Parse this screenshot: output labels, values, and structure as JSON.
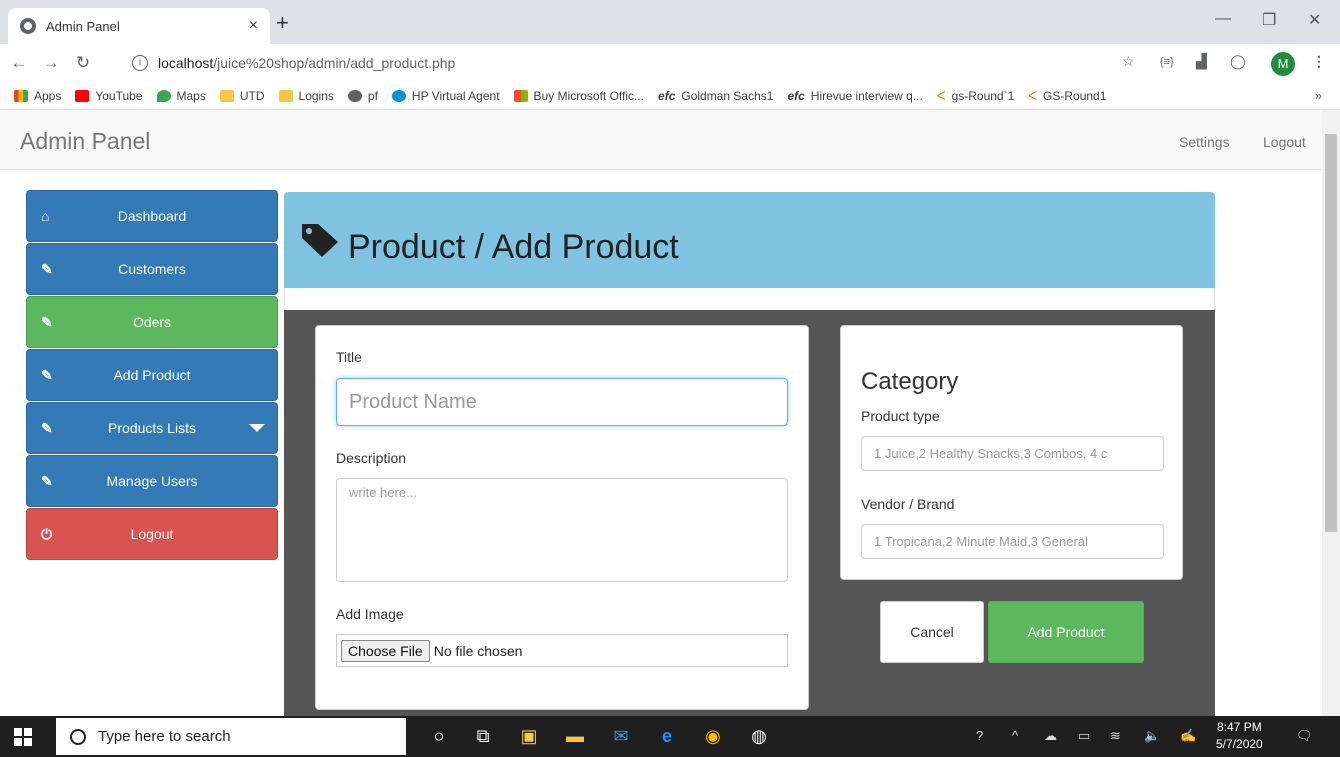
{
  "browser": {
    "tab_title": "Admin Panel",
    "tab_close": "×",
    "new_tab": "+",
    "url_host": "localhost",
    "url_path": "/juice%20shop/admin/add_product.php",
    "profile_initial": "M",
    "bookmarks": [
      "Apps",
      "YouTube",
      "Maps",
      "UTD",
      "Logins",
      "pf",
      "HP Virtual Agent",
      "Buy Microsoft Offic...",
      "Goldman Sachs1",
      "Hirevue interview q...",
      "gs-Round`1",
      "GS-Round1"
    ],
    "bookmarks_more": "»"
  },
  "navbar": {
    "brand": "Admin Panel",
    "settings": "Settings",
    "logout": "Logout"
  },
  "sidebar": {
    "items": [
      {
        "label": "Dashboard",
        "icon": "home-icon",
        "color": "#337ab7"
      },
      {
        "label": "Customers",
        "icon": "edit-icon",
        "color": "#337ab7"
      },
      {
        "label": "Oders",
        "icon": "edit-icon",
        "color": "#5cb85c"
      },
      {
        "label": "Add Product",
        "icon": "edit-icon",
        "color": "#337ab7"
      },
      {
        "label": "Products Lists",
        "icon": "edit-icon",
        "color": "#337ab7"
      },
      {
        "label": "Manage Users",
        "icon": "edit-icon",
        "color": "#337ab7"
      },
      {
        "label": "Logout",
        "icon": "power-icon",
        "color": "#d9534f"
      }
    ]
  },
  "main": {
    "heading": "Product / Add Product",
    "form": {
      "title_label": "Title",
      "title_placeholder": "Product Name",
      "description_label": "Description",
      "description_placeholder": "write here...",
      "image_label": "Add Image",
      "file_button": "Choose File",
      "file_status": "No file chosen"
    },
    "category": {
      "heading": "Category",
      "type_label": "Product type",
      "type_placeholder": "1 Juice,2 Healthy Snacks,3 Combos, 4 c",
      "vendor_label": "Vendor / Brand",
      "vendor_placeholder": "1 Tropicana,2 Minute Maid,3 General"
    },
    "buttons": {
      "cancel": "Cancel",
      "add": "Add Product"
    }
  },
  "taskbar": {
    "search_placeholder": "Type here to search",
    "time": "8:47 PM",
    "date": "5/7/2020"
  }
}
